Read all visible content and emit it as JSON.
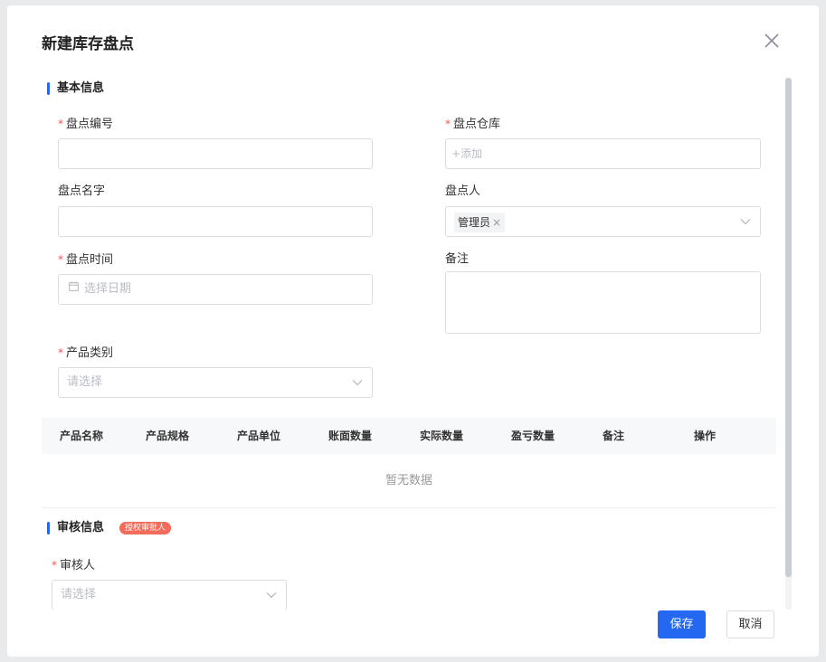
{
  "dialog": {
    "title": "新建库存盘点",
    "close_icon": "close-icon"
  },
  "basic": {
    "title": "基本信息",
    "fields": {
      "code": {
        "label": "盘点编号",
        "required": "*",
        "value": ""
      },
      "warehouse": {
        "label": "盘点仓库",
        "required": "*",
        "placeholder": "+添加"
      },
      "name": {
        "label": "盘点名字",
        "value": ""
      },
      "person": {
        "label": "盘点人",
        "tag": "管理员",
        "tag_close": "×"
      },
      "time": {
        "label": "盘点时间",
        "required": "*",
        "placeholder": "选择日期"
      },
      "remark": {
        "label": "备注",
        "value": ""
      },
      "category": {
        "label": "产品类别",
        "required": "*",
        "placeholder": "请选择"
      }
    }
  },
  "table": {
    "columns": [
      "产品名称",
      "产品规格",
      "产品单位",
      "账面数量",
      "实际数量",
      "盈亏数量",
      "备注",
      "操作"
    ],
    "empty_text": "暂无数据"
  },
  "audit": {
    "title": "审核信息",
    "badge": "授权审批人",
    "reviewer": {
      "label": "审核人",
      "required": "*",
      "placeholder": "请选择"
    }
  },
  "footer": {
    "save_label": "保存",
    "cancel_label": "取消"
  },
  "colors": {
    "primary": "#2468f2",
    "required": "#f5544d",
    "badge": "#f26b5b"
  }
}
